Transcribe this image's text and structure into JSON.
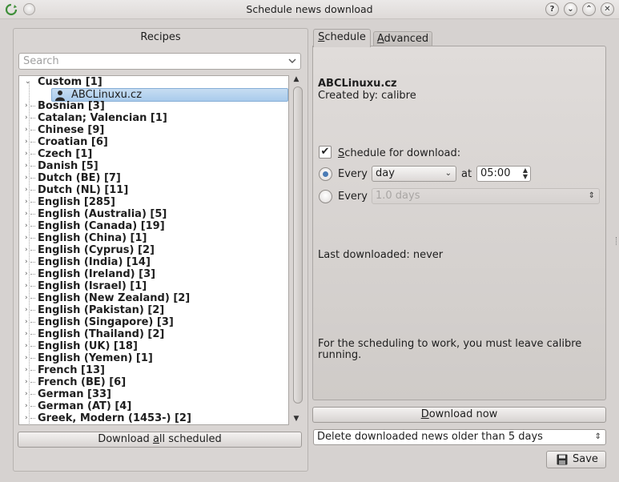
{
  "window": {
    "title": "Schedule news download",
    "controls": [
      "?",
      "⌄",
      "⌃",
      "✕"
    ]
  },
  "recipes": {
    "label": "Recipes",
    "search_placeholder": "Search",
    "tree": [
      {
        "label": "Custom [1]",
        "expanded": true
      },
      {
        "label": "ABCLinuxu.cz",
        "child": true,
        "selected": true
      },
      {
        "label": "Bosnian [3]"
      },
      {
        "label": "Catalan; Valencian [1]"
      },
      {
        "label": "Chinese [9]"
      },
      {
        "label": "Croatian [6]"
      },
      {
        "label": "Czech [1]"
      },
      {
        "label": "Danish [5]"
      },
      {
        "label": "Dutch (BE) [7]"
      },
      {
        "label": "Dutch (NL) [11]"
      },
      {
        "label": "English [285]"
      },
      {
        "label": "English (Australia) [5]"
      },
      {
        "label": "English (Canada) [19]"
      },
      {
        "label": "English (China) [1]"
      },
      {
        "label": "English (Cyprus) [2]"
      },
      {
        "label": "English (India) [14]"
      },
      {
        "label": "English (Ireland) [3]"
      },
      {
        "label": "English (Israel) [1]"
      },
      {
        "label": "English (New Zealand) [2]"
      },
      {
        "label": "English (Pakistan) [2]"
      },
      {
        "label": "English (Singapore) [3]"
      },
      {
        "label": "English (Thailand) [2]"
      },
      {
        "label": "English (UK) [18]"
      },
      {
        "label": "English (Yemen) [1]"
      },
      {
        "label": "French [13]"
      },
      {
        "label": "French (BE) [6]"
      },
      {
        "label": "German [33]"
      },
      {
        "label": "German (AT) [4]"
      },
      {
        "label": "Greek, Modern (1453-) [2]"
      }
    ],
    "download_all_pre": "Download ",
    "download_all_u": "a",
    "download_all_post": "ll scheduled"
  },
  "tabs": {
    "schedule_u": "S",
    "schedule_rest": "chedule",
    "advanced_u": "A",
    "advanced_rest": "dvanced"
  },
  "schedule": {
    "recipe_title": "ABCLinuxu.cz",
    "created_by": "Created by: calibre",
    "checkbox_mark": "✔",
    "schedule_label_u": "S",
    "schedule_label_rest": "chedule for download:",
    "every_label": "Every",
    "every_unit": "day",
    "at_label": "at",
    "time": "05:00",
    "every2_label": "Every",
    "days_value": "1.0 days",
    "last_downloaded": "Last downloaded: never",
    "note_line1": "For the scheduling to work, you must leave calibre",
    "note_line2": "running."
  },
  "actions": {
    "download_now_u": "D",
    "download_now_rest": "ownload now",
    "delete_older": "Delete downloaded news older than 5 days",
    "save_label": "Save"
  }
}
